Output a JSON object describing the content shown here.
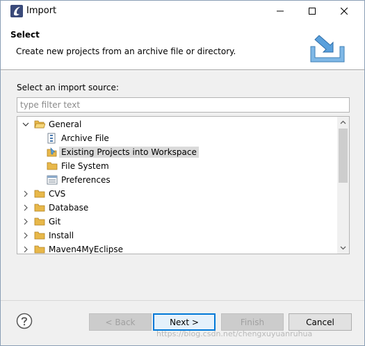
{
  "window": {
    "title": "Import"
  },
  "banner": {
    "title": "Select",
    "description": "Create new projects from an archive file or directory."
  },
  "source": {
    "label": "Select an import source:",
    "filter_placeholder": "type filter text"
  },
  "tree": {
    "items": [
      {
        "label": "General",
        "expanded": true,
        "icon": "folder-open-icon"
      },
      {
        "label": "Archive File",
        "icon": "archive-file-icon"
      },
      {
        "label": "Existing Projects into Workspace",
        "icon": "existing-projects-icon",
        "selected": true
      },
      {
        "label": "File System",
        "icon": "folder-icon"
      },
      {
        "label": "Preferences",
        "icon": "preferences-icon"
      },
      {
        "label": "CVS",
        "expanded": false,
        "icon": "folder-icon"
      },
      {
        "label": "Database",
        "expanded": false,
        "icon": "folder-icon"
      },
      {
        "label": "Git",
        "expanded": false,
        "icon": "folder-icon"
      },
      {
        "label": "Install",
        "expanded": false,
        "icon": "folder-icon"
      },
      {
        "label": "Maven4MyEclipse",
        "expanded": false,
        "icon": "folder-icon"
      }
    ]
  },
  "buttons": {
    "back": "< Back",
    "next": "Next >",
    "finish": "Finish",
    "cancel": "Cancel"
  },
  "watermark": "https://blog.csdn.net/chengxuyuanruhua",
  "colors": {
    "selection": "#dadada",
    "folder": "#e8b84a",
    "default_button_border": "#0078d7"
  }
}
